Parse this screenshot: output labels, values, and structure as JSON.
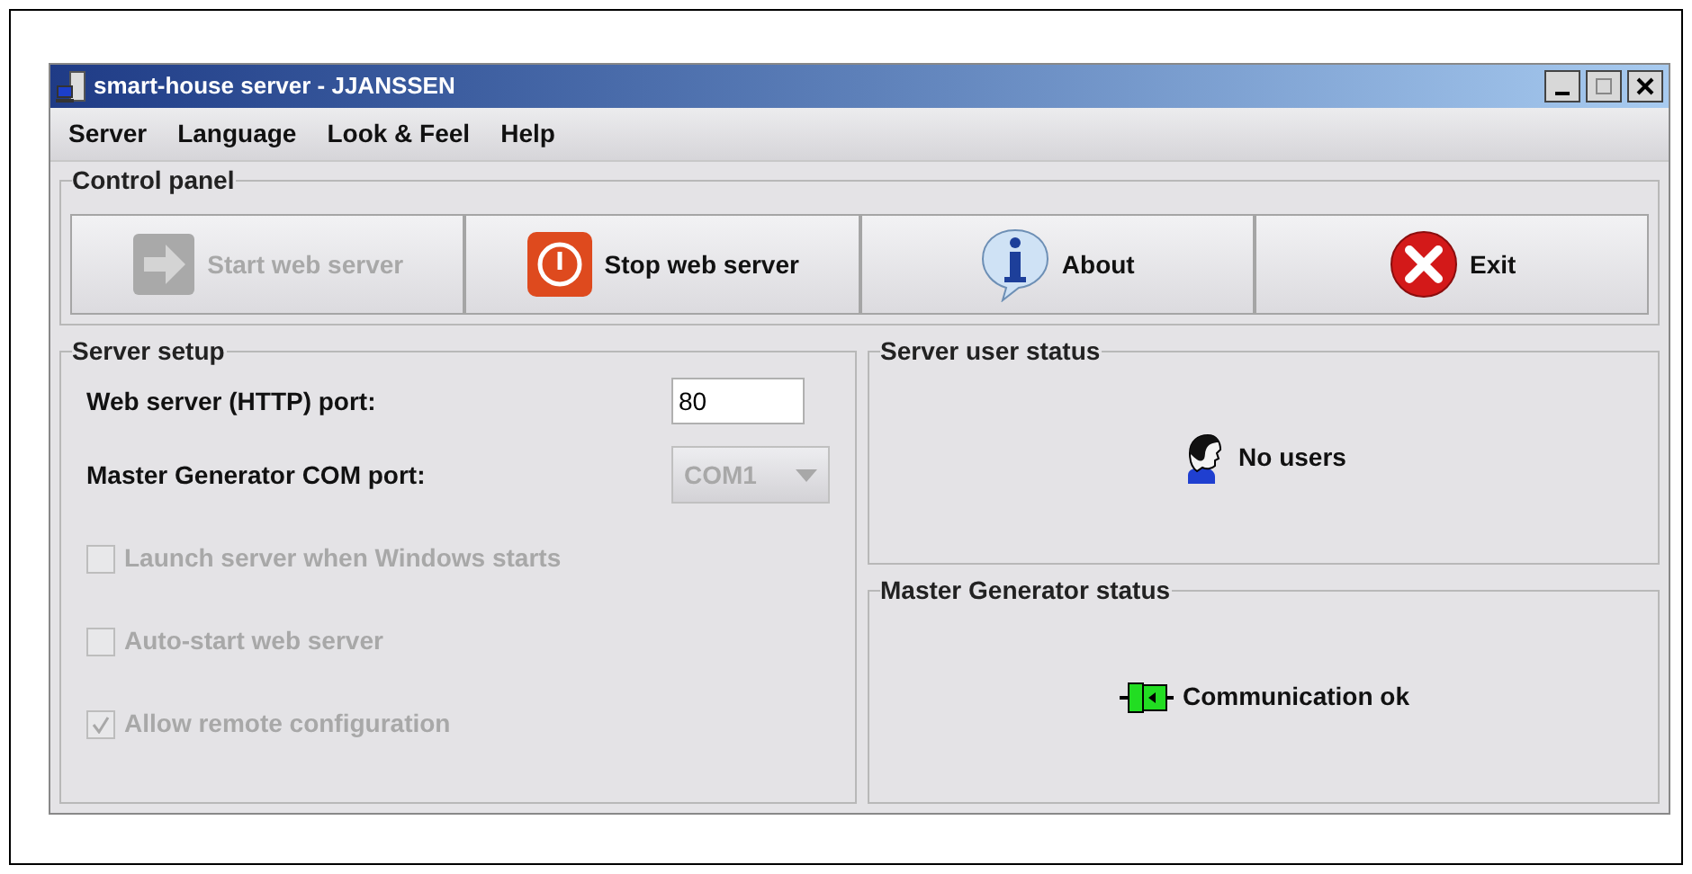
{
  "window": {
    "title": "smart-house server - JJANSSEN"
  },
  "menu": [
    "Server",
    "Language",
    "Look & Feel",
    "Help"
  ],
  "control_panel": {
    "title": "Control panel",
    "buttons": [
      {
        "kind": "start",
        "label": "Start web server",
        "disabled": true
      },
      {
        "kind": "stop",
        "label": "Stop web server",
        "disabled": false
      },
      {
        "kind": "about",
        "label": "About",
        "disabled": false
      },
      {
        "kind": "exit",
        "label": "Exit",
        "disabled": false
      }
    ]
  },
  "server_setup": {
    "title": "Server setup",
    "http_port": {
      "label": "Web server (HTTP) port:",
      "value": "80"
    },
    "com_port": {
      "label": "Master Generator COM port:",
      "value": "COM1",
      "disabled": true
    },
    "options": [
      {
        "label": "Launch server when Windows starts",
        "checked": false,
        "disabled": true
      },
      {
        "label": "Auto-start web server",
        "checked": false,
        "disabled": true
      },
      {
        "label": "Allow remote configuration",
        "checked": true,
        "disabled": true
      }
    ]
  },
  "user_status": {
    "title": "Server user status",
    "text": "No users"
  },
  "generator_status": {
    "title": "Master Generator status",
    "text": "Communication ok"
  }
}
